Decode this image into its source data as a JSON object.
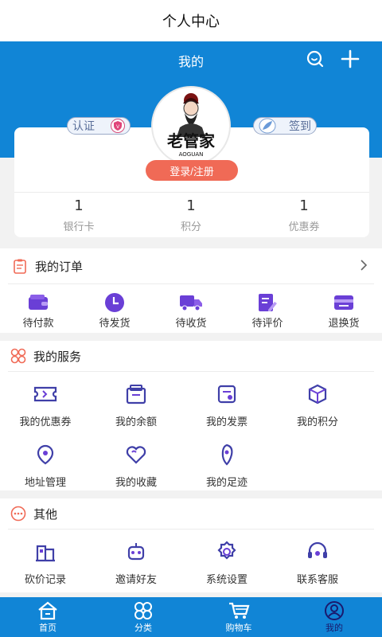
{
  "titlebar": {
    "title": "个人中心"
  },
  "header": {
    "title": "我的",
    "search_icon": "search-icon",
    "add_icon": "plus-icon"
  },
  "profile": {
    "cert_label": "认证",
    "sign_label": "签到",
    "logo_text": "老管家",
    "logo_sub": "AOGUAN",
    "login_label": "登录/注册",
    "stats": [
      {
        "value": "1",
        "label": "银行卡"
      },
      {
        "value": "1",
        "label": "积分"
      },
      {
        "value": "1",
        "label": "优惠券"
      }
    ]
  },
  "orders": {
    "title": "我的订单",
    "items": [
      {
        "label": "待付款",
        "icon": "wallet-icon"
      },
      {
        "label": "待发货",
        "icon": "clock-icon"
      },
      {
        "label": "待收货",
        "icon": "truck-icon"
      },
      {
        "label": "待评价",
        "icon": "edit-icon"
      },
      {
        "label": "退换货",
        "icon": "return-icon"
      }
    ]
  },
  "services": {
    "title": "我的服务",
    "items": [
      {
        "label": "我的优惠券",
        "icon": "coupon-icon"
      },
      {
        "label": "我的余额",
        "icon": "balance-icon"
      },
      {
        "label": "我的发票",
        "icon": "invoice-icon"
      },
      {
        "label": "我的积分",
        "icon": "points-icon"
      },
      {
        "label": "地址管理",
        "icon": "location-icon"
      },
      {
        "label": "我的收藏",
        "icon": "heart-icon"
      },
      {
        "label": "我的足迹",
        "icon": "footprint-icon"
      }
    ]
  },
  "others": {
    "title": "其他",
    "items": [
      {
        "label": "砍价记录",
        "icon": "building-icon"
      },
      {
        "label": "邀请好友",
        "icon": "robot-icon"
      },
      {
        "label": "系统设置",
        "icon": "settings-icon"
      },
      {
        "label": "联系客服",
        "icon": "headset-icon"
      }
    ]
  },
  "tabbar": {
    "items": [
      {
        "label": "首页",
        "icon": "home-icon"
      },
      {
        "label": "分类",
        "icon": "category-icon"
      },
      {
        "label": "购物车",
        "icon": "cart-icon"
      },
      {
        "label": "我的",
        "icon": "user-icon"
      }
    ],
    "active": "我的"
  },
  "colors": {
    "primary": "#1185d6",
    "accent": "#f06a56",
    "icon_purple": "#6a3fd6"
  }
}
